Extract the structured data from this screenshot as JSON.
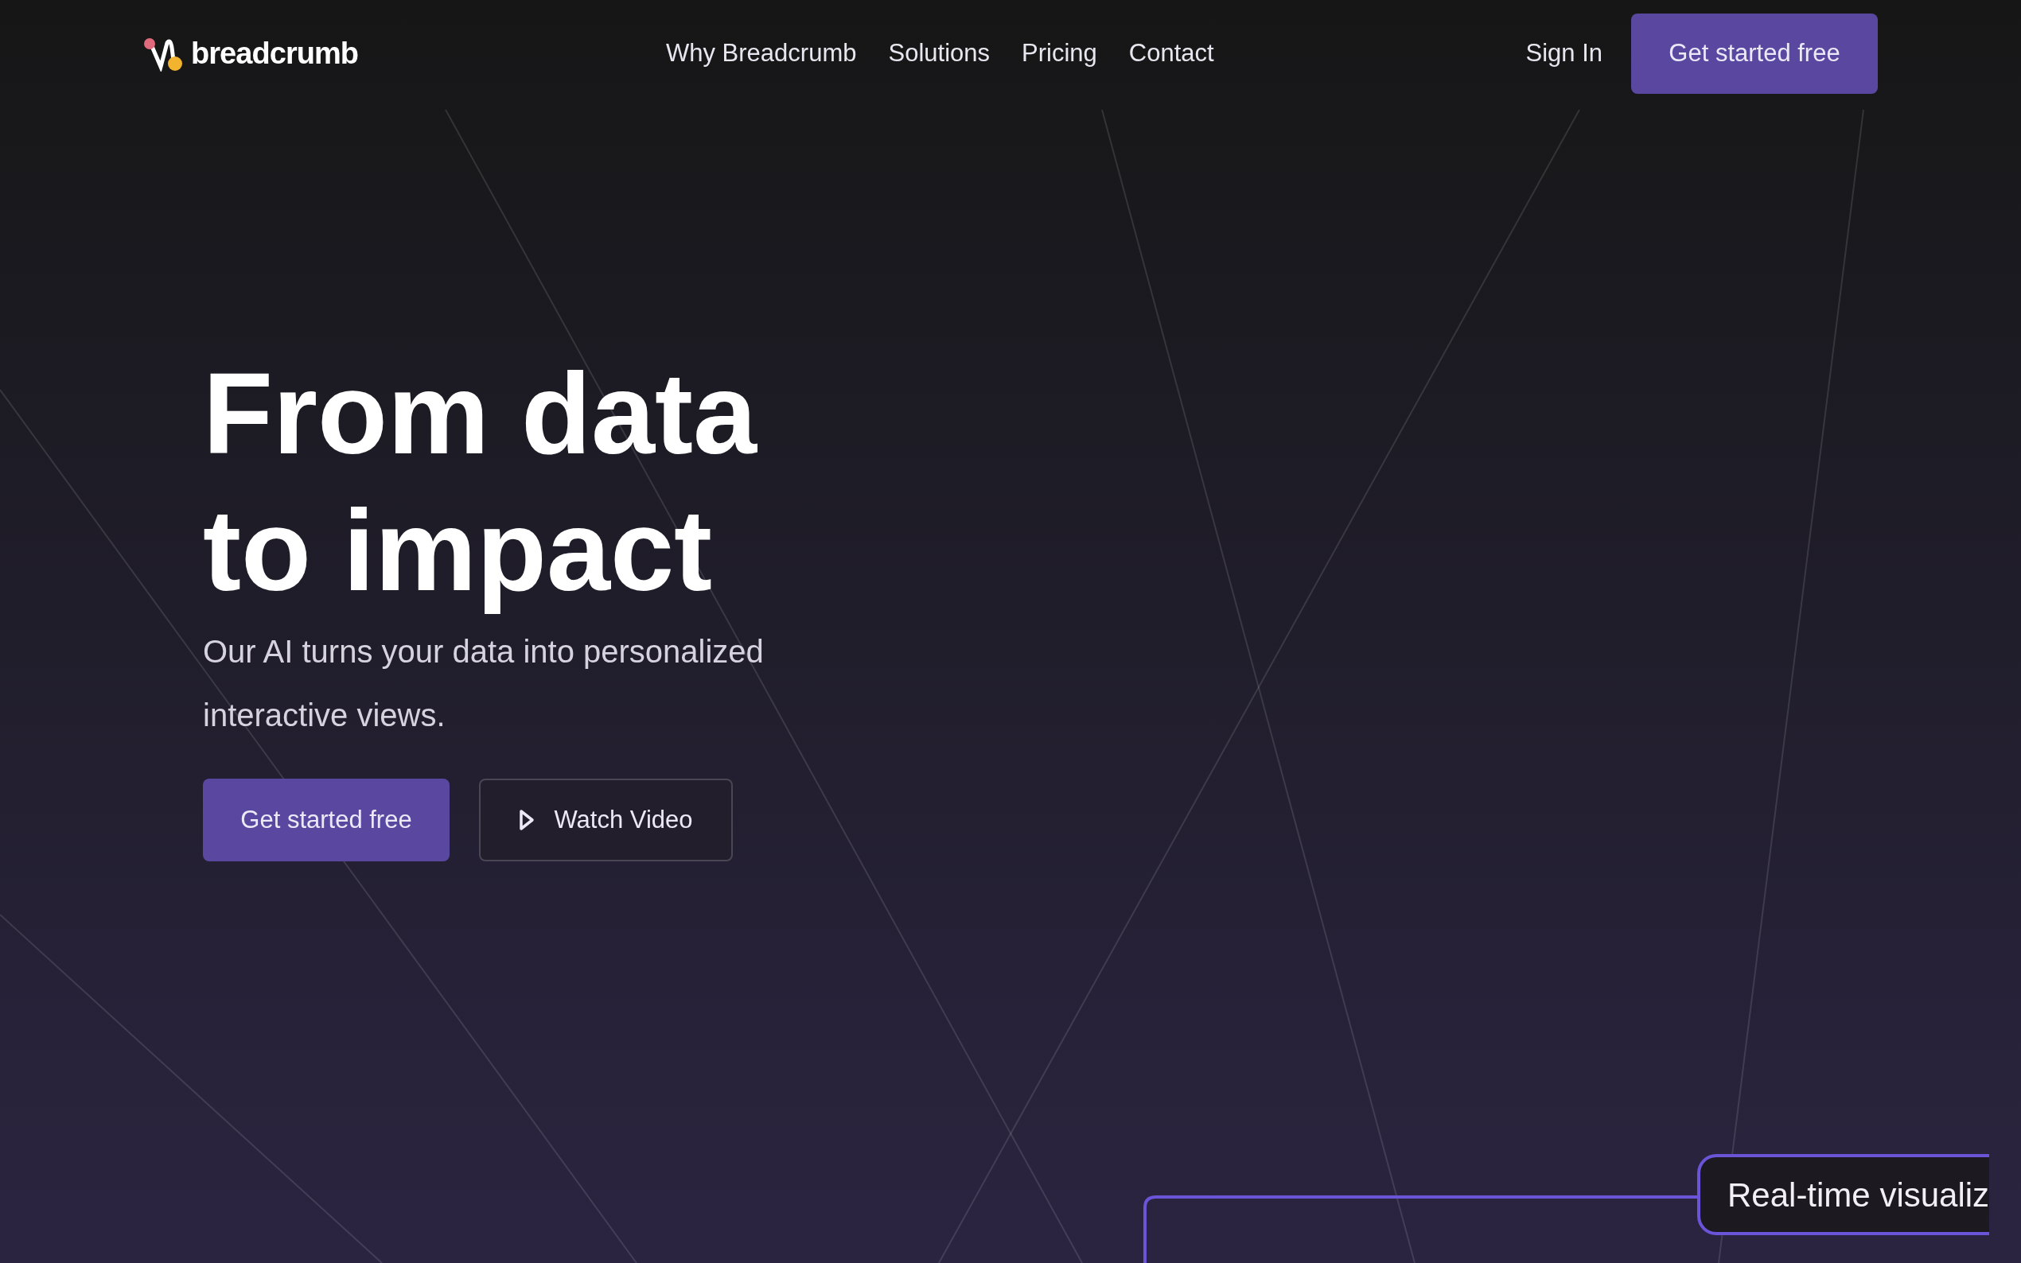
{
  "brand": {
    "name": "breadcrumb"
  },
  "nav": {
    "links": [
      "Why Breadcrumb",
      "Solutions",
      "Pricing",
      "Contact"
    ],
    "sign_in": "Sign In",
    "cta": "Get started free"
  },
  "hero": {
    "headline_lines": [
      "From data",
      "to impact"
    ],
    "subtitle": "Our AI turns your data into personalized interactive views.",
    "primary_button": "Get started free",
    "secondary_button": "Watch Video"
  },
  "diagram": {
    "label": "Real-time visualiz"
  }
}
